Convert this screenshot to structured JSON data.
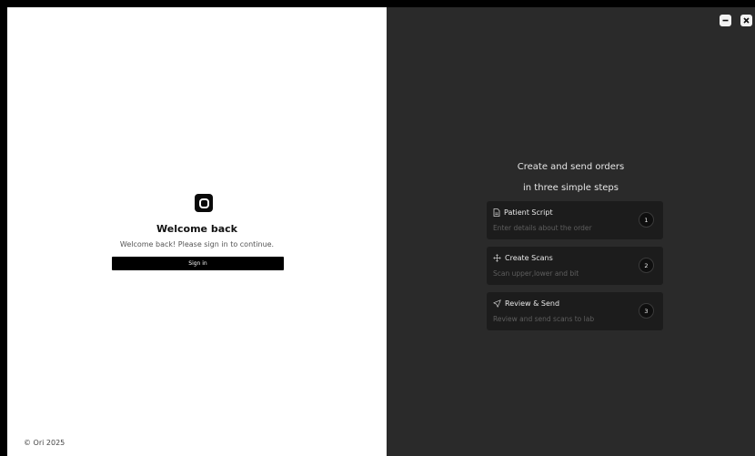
{
  "login": {
    "title": "Welcome back",
    "subtitle": "Welcome back! Please sign in to continue.",
    "sign_in_label": "Sign in",
    "copyright": "© Ori 2025",
    "logo_icon": "ori-logo-icon"
  },
  "window": {
    "minimize_icon": "minimize-icon",
    "close_icon": "close-icon"
  },
  "promo": {
    "heading_line1": "Create and send orders",
    "heading_line2": "in three simple steps",
    "steps": [
      {
        "title": "Patient Script",
        "description": "Enter details about the order",
        "number": "1",
        "icon": "document-icon"
      },
      {
        "title": "Create Scans",
        "description": "Scan upper,lower and bit",
        "number": "2",
        "icon": "move-icon"
      },
      {
        "title": "Review & Send",
        "description": "Review and send scans to lab",
        "number": "3",
        "icon": "send-icon"
      }
    ]
  },
  "colors": {
    "left_bg": "#ffffff",
    "right_bg": "#2a2a2a",
    "card_bg": "#1c1c1c",
    "button_bg": "#000000"
  }
}
